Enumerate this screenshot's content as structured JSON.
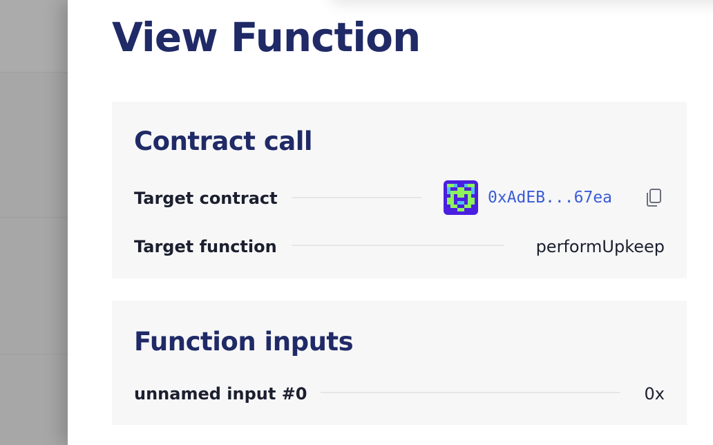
{
  "page": {
    "title": "View Function"
  },
  "contract_call": {
    "title": "Contract call",
    "target_contract": {
      "label": "Target contract",
      "address": "0xAdEB...67ea",
      "avatar_icon": "identicon",
      "copy_icon": "copy-icon"
    },
    "target_function": {
      "label": "Target function",
      "value": "performUpkeep"
    }
  },
  "function_inputs": {
    "title": "Function inputs",
    "items": [
      {
        "label": "unnamed input #0",
        "value": "0x"
      }
    ]
  },
  "colors": {
    "heading": "#1f2a66",
    "link": "#3a5bd6",
    "card_bg": "#f7f7f8",
    "identicon_primary": "#4a1fe0",
    "identicon_secondary": "#8ef25a",
    "identicon_accent": "#4ec3e8"
  }
}
